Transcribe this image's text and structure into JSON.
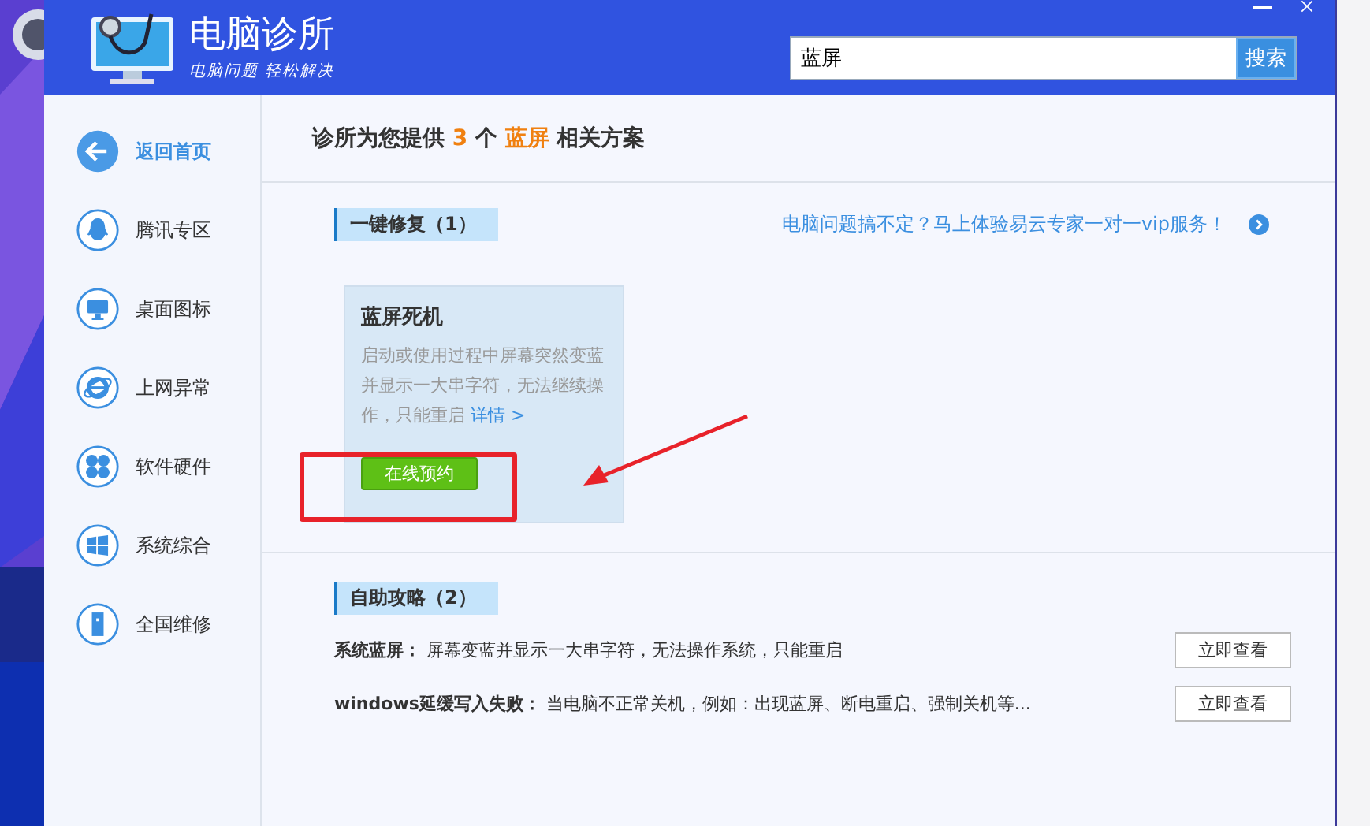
{
  "header": {
    "title": "电脑诊所",
    "slogan": "电脑问题 轻松解决",
    "search": {
      "value": "蓝屏",
      "button": "搜索"
    }
  },
  "sidebar": {
    "items": [
      {
        "kind": "back",
        "label": "返回首页",
        "selected": true
      },
      {
        "kind": "penguin",
        "label": "腾讯专区",
        "selected": false
      },
      {
        "kind": "monitor",
        "label": "桌面图标",
        "selected": false
      },
      {
        "kind": "browser",
        "label": "上网异常",
        "selected": false
      },
      {
        "kind": "clover",
        "label": "软件硬件",
        "selected": false
      },
      {
        "kind": "windows",
        "label": "系统综合",
        "selected": false
      },
      {
        "kind": "tower",
        "label": "全国维修",
        "selected": false
      }
    ]
  },
  "headline": {
    "prefix": "诊所为您提供",
    "count": "3",
    "unit": "个",
    "keyword": "蓝屏",
    "suffix": "相关方案"
  },
  "quick_fix": {
    "tag": "一键修复（1）",
    "promo": "电脑问题搞不定？马上体验易云专家一对一vip服务！",
    "cards": [
      {
        "title": "蓝屏死机",
        "description": "启动或使用过程中屏幕突然变蓝并显示一大串字符，无法继续操作，只能重启",
        "link": "详情 >",
        "button": "在线预约"
      }
    ]
  },
  "guides": {
    "tag": "自助攻略（2）",
    "items": [
      {
        "title": "系统蓝屏：",
        "text": "屏幕变蓝并显示一大串字符，无法操作系统，只能重启",
        "button": "立即查看"
      },
      {
        "title": "windows延缓写入失败：",
        "text": "当电脑不正常关机，例如：出现蓝屏、断电重启、强制关机等...",
        "button": "立即查看"
      }
    ]
  }
}
